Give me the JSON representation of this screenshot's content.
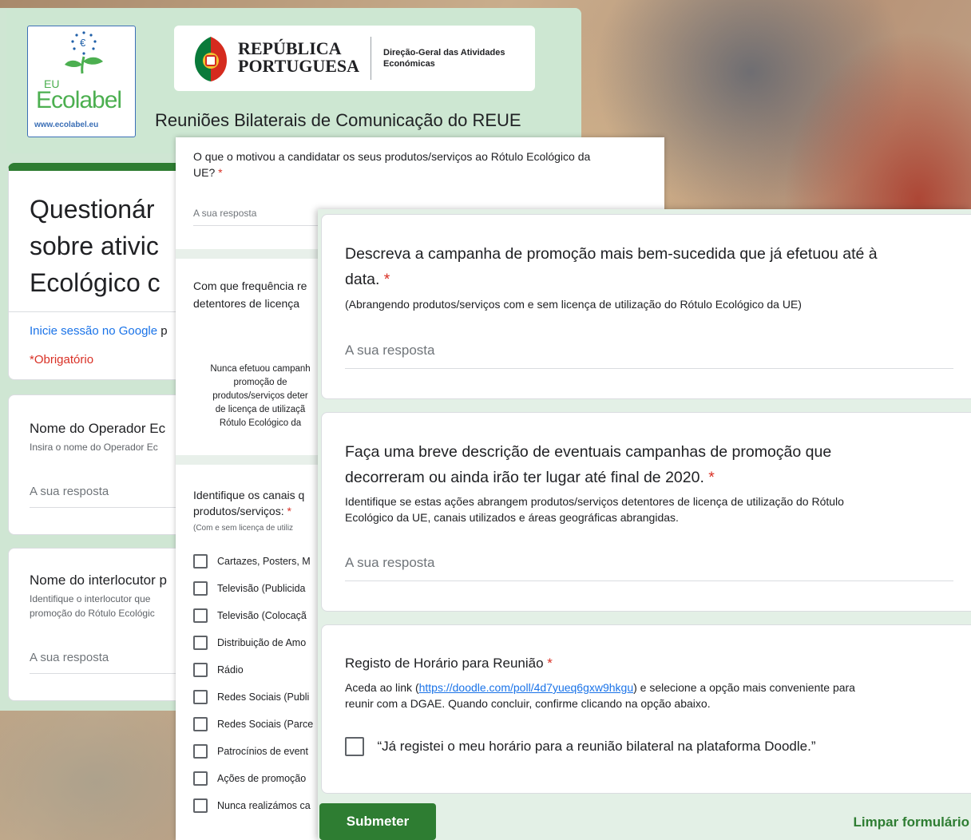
{
  "header": {
    "ecolabel_eu": "EU",
    "ecolabel_name": "Ecolabel",
    "ecolabel_url": "www.ecolabel.eu",
    "republic_line1": "REPÚBLICA",
    "republic_line2": "PORTUGUESA",
    "dgae_line1": "Direção-Geral das Atividades",
    "dgae_line2": "Económicas",
    "banner_title": "Reuniões Bilaterais de Comunicação do REUE"
  },
  "left": {
    "title_lines": [
      "Questionár",
      "sobre ativic",
      "Ecológico c"
    ],
    "signin_link": "Inicie sessão no Google",
    "signin_rest": " p",
    "required_note": "*Obrigatório",
    "q_operator": {
      "title": "Nome do Operador Ec",
      "help": "Insira o nome do Operador Ec",
      "placeholder": "A sua resposta"
    },
    "q_contact": {
      "title": "Nome do interlocutor p",
      "help_lines": [
        "Identifique o interlocutor que",
        "promoção do Rótulo Ecológic"
      ],
      "placeholder": "A sua resposta"
    }
  },
  "middle": {
    "q_motivation": {
      "title_lines": [
        "O que o motivou a candidatar os seus produtos/serviços ao Rótulo Ecológico da",
        "UE?"
      ],
      "required": "*",
      "placeholder": "A sua resposta"
    },
    "q_frequency": {
      "title_lines": [
        "Com que frequência re",
        "detentores de licença"
      ]
    },
    "scale_label_lines": [
      "Nunca efetuou campanh",
      "promoção de",
      "produtos/serviços deter",
      "de licença de utilizaçã",
      "Rótulo Ecológico da"
    ],
    "q_channels": {
      "title_lines": [
        "Identifique os canais q",
        "produtos/serviços:"
      ],
      "required": "*",
      "note": "(Com e sem licença de utiliz"
    },
    "channel_options": [
      "Cartazes, Posters, M",
      "Televisão (Publicida",
      "Televisão (Colocaçã",
      "Distribuição de Amo",
      "Rádio",
      "Redes Sociais (Publi",
      "Redes Sociais (Parce",
      "Patrocínios de event",
      "Ações de promoção",
      "Nunca realizámos ca"
    ]
  },
  "right": {
    "q_campaign": {
      "title_lines": [
        "Descreva a campanha de promoção mais bem-sucedida que já efetuou até à",
        "data."
      ],
      "required": "*",
      "help": "(Abrangendo produtos/serviços com e sem licença de utilização do Rótulo Ecológico da UE)",
      "placeholder": "A sua resposta"
    },
    "q_description": {
      "title_lines": [
        "Faça uma breve descrição de eventuais campanhas de promoção que",
        "decorreram ou ainda irão ter lugar até final de 2020."
      ],
      "required": "*",
      "help_lines": [
        "Identifique se estas ações abrangem produtos/serviços detentores de licença de utilização do Rótulo",
        "Ecológico da UE, canais utilizados e áreas geográficas abrangidas."
      ],
      "placeholder": "A sua resposta"
    },
    "q_schedule": {
      "title": "Registo de Horário para Reunião",
      "required": "*",
      "help_before": "Aceda ao link (",
      "link": "https://doodle.com/poll/4d7yueq6gxw9hkgu",
      "help_after": ") e selecione a opção mais conveniente para",
      "help_line2": "reunir com a DGAE. Quando concluir, confirme clicando na opção abaixo.",
      "checkbox_label": "“Já registei o meu horário para a reunião bilateral na plataforma Doodle.”"
    },
    "submit": "Submeter",
    "clear": "Limpar formulário"
  }
}
